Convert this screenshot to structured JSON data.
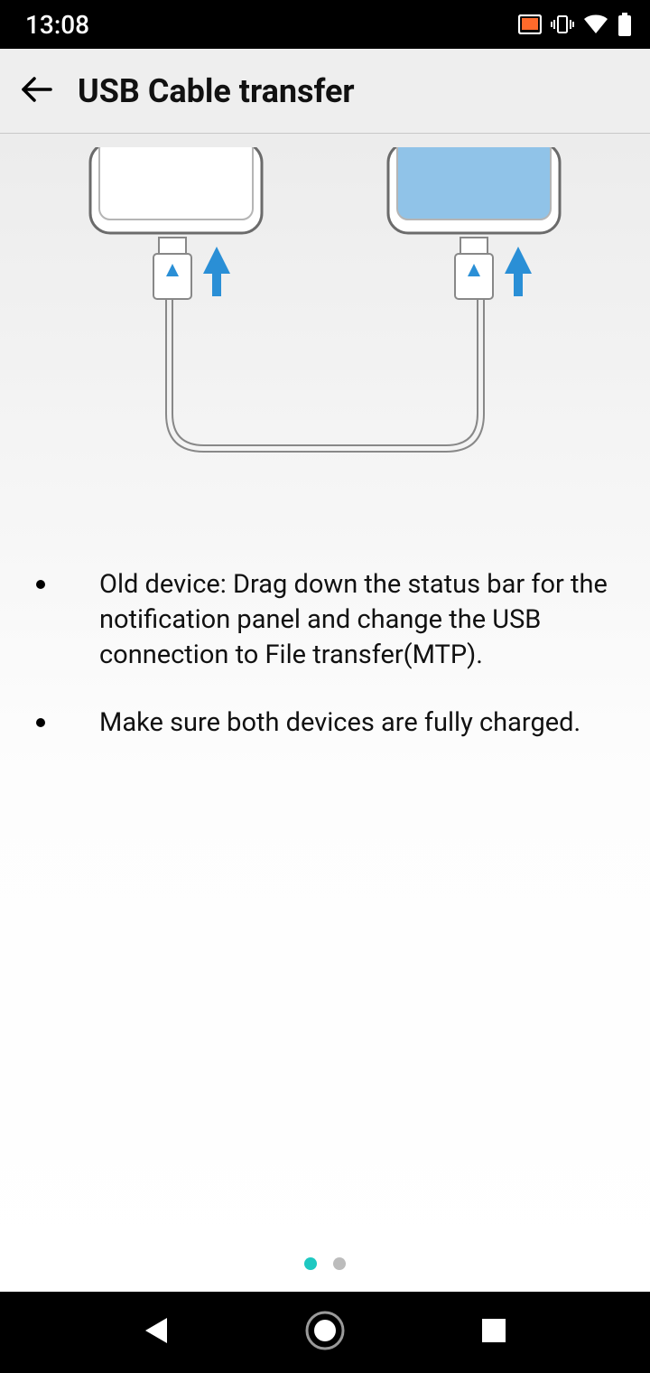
{
  "status_bar": {
    "time": "13:08"
  },
  "header": {
    "title": "USB Cable transfer"
  },
  "instructions": {
    "item1": "Old device: Drag down the status bar for the notification panel and change the USB connection to File transfer(MTP).",
    "item2": "Make sure both devices are fully charged."
  },
  "pager": {
    "current": 1,
    "total": 2
  }
}
